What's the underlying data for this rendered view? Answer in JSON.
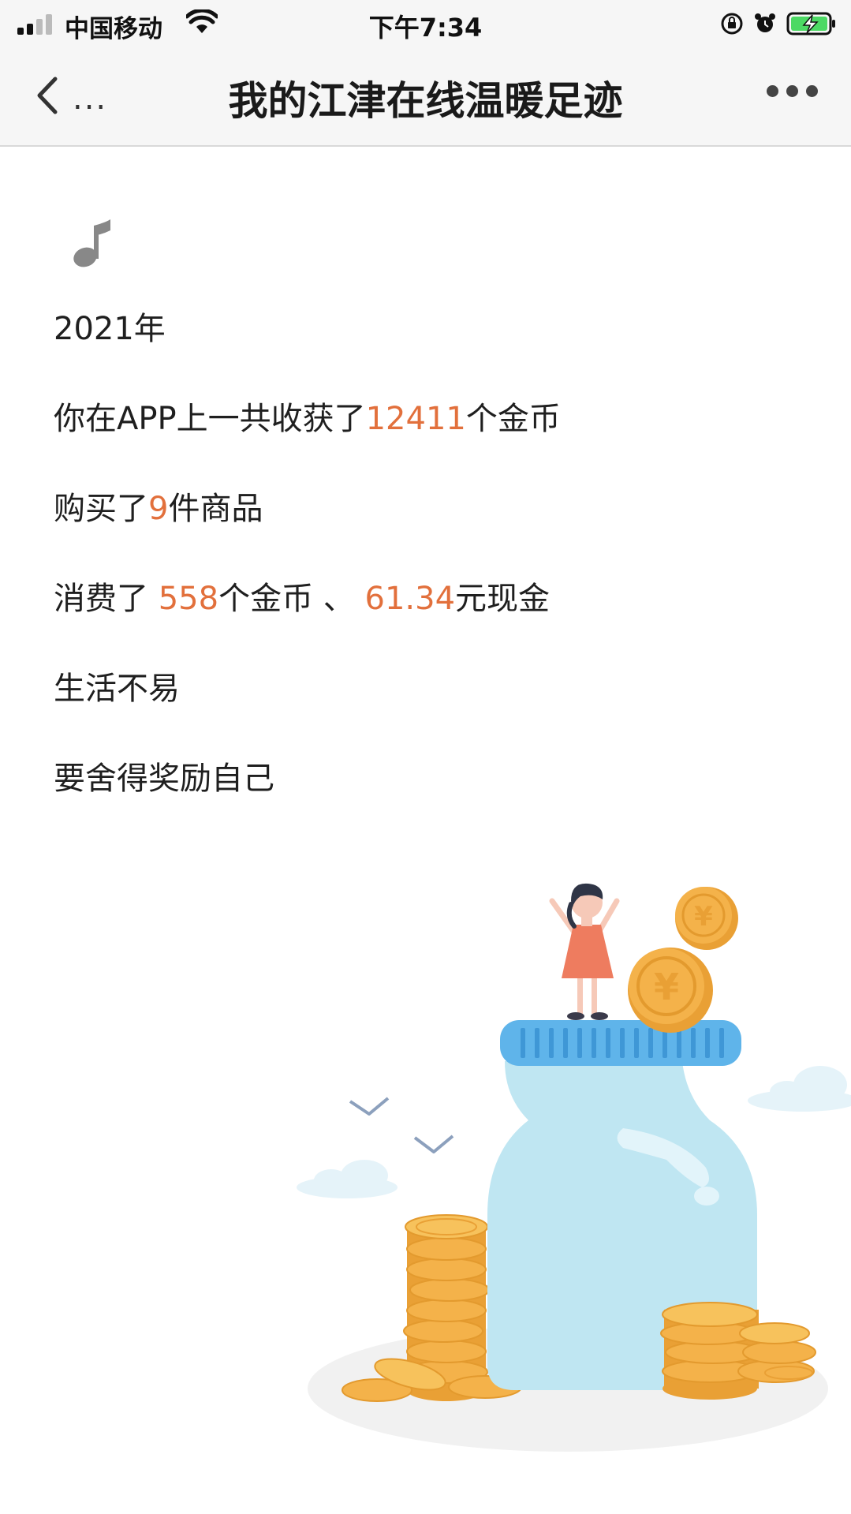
{
  "status_bar": {
    "carrier": "中国移动",
    "time": "下午7:34",
    "icons": [
      "signal-icon",
      "wifi-icon",
      "orientation-lock-icon",
      "alarm-icon",
      "battery-charging-icon"
    ]
  },
  "nav": {
    "back_more": "...",
    "title": "我的江津在线温暖足迹",
    "icons": [
      "back-icon",
      "more-icon"
    ]
  },
  "content": {
    "music_icon": "music-note-icon",
    "year": "2021年",
    "coins_line": {
      "before": "你在APP上一共收获了",
      "coins": "12411",
      "after": "个金币"
    },
    "purchase_line": {
      "before": "购买了",
      "count": "9",
      "after": "件商品"
    },
    "spend_line": {
      "before": "消费了 ",
      "coins": "558",
      "middle": "个金币 、 ",
      "cash": "61.34",
      "after": "元现金"
    },
    "life_line": "生活不易",
    "reward_line": "要舍得奖励自己"
  },
  "colors": {
    "highlight": "#e2703c",
    "jar": "#bfe6f2",
    "lid": "#5fb4ea",
    "coin": "#f4b24a"
  }
}
